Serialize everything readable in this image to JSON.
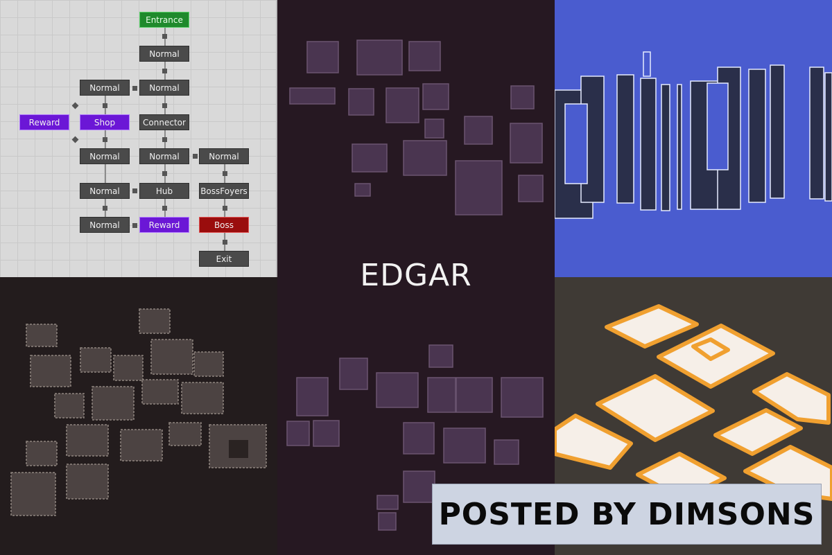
{
  "title": "EDGAR",
  "watermark": "POSTED BY DIMSONS",
  "graph": {
    "nodes": [
      {
        "label": "Entrance",
        "type": "entrance"
      },
      {
        "label": "Normal",
        "type": "normal"
      },
      {
        "label": "Normal",
        "type": "normal"
      },
      {
        "label": "Normal",
        "type": "normal"
      },
      {
        "label": "Reward",
        "type": "reward"
      },
      {
        "label": "Shop",
        "type": "reward"
      },
      {
        "label": "Connector",
        "type": "normal"
      },
      {
        "label": "Normal",
        "type": "normal"
      },
      {
        "label": "Normal",
        "type": "normal"
      },
      {
        "label": "Normal",
        "type": "normal"
      },
      {
        "label": "Normal",
        "type": "normal"
      },
      {
        "label": "Hub",
        "type": "normal"
      },
      {
        "label": "BossFoyers",
        "type": "normal"
      },
      {
        "label": "Normal",
        "type": "normal"
      },
      {
        "label": "Reward",
        "type": "reward"
      },
      {
        "label": "Boss",
        "type": "boss"
      },
      {
        "label": "Exit",
        "type": "normal"
      }
    ]
  },
  "colors": {
    "entrance": "#1f8a2c",
    "reward": "#6b17d6",
    "boss": "#9a0d0d",
    "normal": "#4a4a4a",
    "purple_rooms": "#4a3550",
    "blue_background": "#4a5ccf",
    "iso_walls": "#f0a030"
  }
}
